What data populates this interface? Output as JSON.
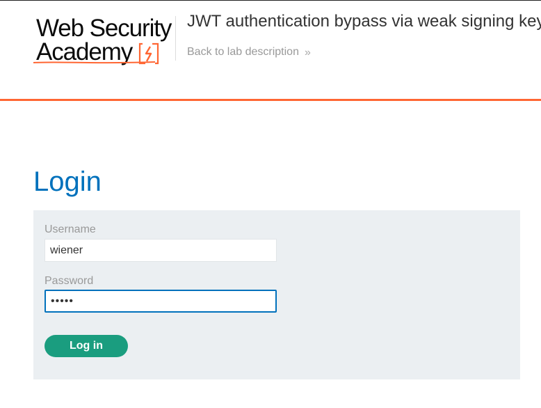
{
  "header": {
    "brand_line1": "Web Security",
    "brand_line2": "Academy",
    "lab_title": "JWT authentication bypass via weak signing key",
    "back_link_label": "Back to lab description",
    "back_link_icon": "double-chevron-right-icon",
    "logo_icon": "lightning-bolt-icon",
    "accent_color": "#ff6633"
  },
  "main": {
    "heading": "Login",
    "heading_color": "#0071bc",
    "panel_color": "#ebeff2",
    "form": {
      "username_label": "Username",
      "username_value": "wiener",
      "password_label": "Password",
      "password_value": "peter",
      "submit_label": "Log in",
      "submit_color": "#1a9d7f"
    }
  }
}
